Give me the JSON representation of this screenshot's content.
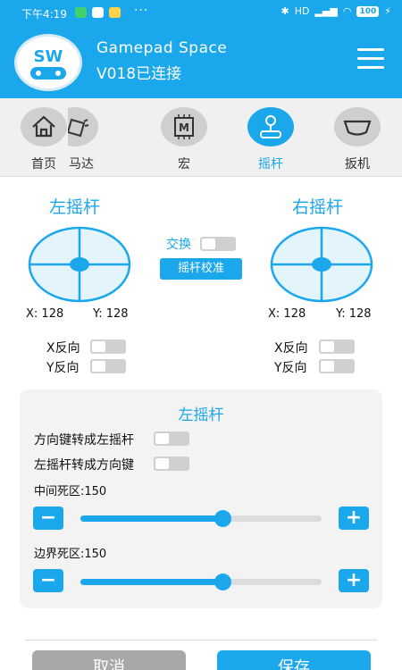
{
  "status_bar": {
    "time": "下午4:19",
    "dots": "···",
    "network": "HD",
    "battery": "100"
  },
  "header": {
    "app_name": "Gamepad Space",
    "connection_status": "V018已连接",
    "logo_text": "SW"
  },
  "tabs": [
    {
      "label": "首页",
      "icon": "home-icon"
    },
    {
      "label": "马达",
      "icon": "motor-icon"
    },
    {
      "label": "宏",
      "icon": "macro-icon"
    },
    {
      "label": "摇杆",
      "icon": "joystick-icon",
      "active": true
    },
    {
      "label": "扳机",
      "icon": "trigger-icon"
    }
  ],
  "left_stick": {
    "title": "左摇杆",
    "x_readout": "X: 128",
    "y_readout": "Y: 128",
    "x_invert_label": "X反向",
    "y_invert_label": "Y反向"
  },
  "right_stick": {
    "title": "右摇杆",
    "x_readout": "X: 128",
    "y_readout": "Y: 128",
    "x_invert_label": "X反向",
    "y_invert_label": "Y反向"
  },
  "middle": {
    "swap_label": "交换",
    "calibrate_label": "摇杆校准"
  },
  "settings": {
    "title": "左摇杆",
    "dpad_to_stick_label": "方向键转成左摇杆",
    "stick_to_dpad_label": "左摇杆转成方向键",
    "center_deadzone_label": "中间死区:150",
    "edge_deadzone_label": "边界死区:150",
    "center_deadzone_fraction": 0.59,
    "edge_deadzone_fraction": 0.59
  },
  "footer": {
    "cancel_label": "取消",
    "save_label": "保存"
  },
  "colors": {
    "accent": "#1aa7ec",
    "stick_fill": "#e3f4fc"
  }
}
